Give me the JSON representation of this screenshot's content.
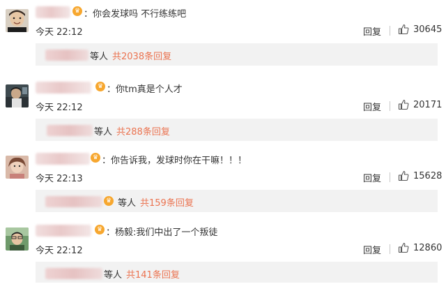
{
  "comments": [
    {
      "text": "：你会发球吗 不行练练吧",
      "time": "今天 22:12",
      "reply_label": "回复",
      "likes": "30645",
      "sub_suffix": "等人",
      "sub_count": "共2038条回复"
    },
    {
      "text": "：你tm真是个人才",
      "time": "今天 22:12",
      "reply_label": "回复",
      "likes": "20171",
      "sub_suffix": "等人",
      "sub_count": "共288条回复"
    },
    {
      "text": "：你告诉我，发球时你在干嘛！！！",
      "time": "今天 22:13",
      "reply_label": "回复",
      "likes": "15628",
      "sub_suffix": "等人",
      "sub_count": "共159条回复"
    },
    {
      "text": "：杨毅:我们中出了一个叛徒",
      "time": "今天 22:12",
      "reply_label": "回复",
      "likes": "12860",
      "sub_suffix": "等人",
      "sub_count": "共141条回复"
    }
  ],
  "colors": {
    "link": "#eb7350",
    "vip_badge": "#f7a72f",
    "subreply_bg": "#f2f2f2"
  },
  "icons": {
    "like": "thumbs-up-icon",
    "vip": "vip-crown-icon"
  }
}
